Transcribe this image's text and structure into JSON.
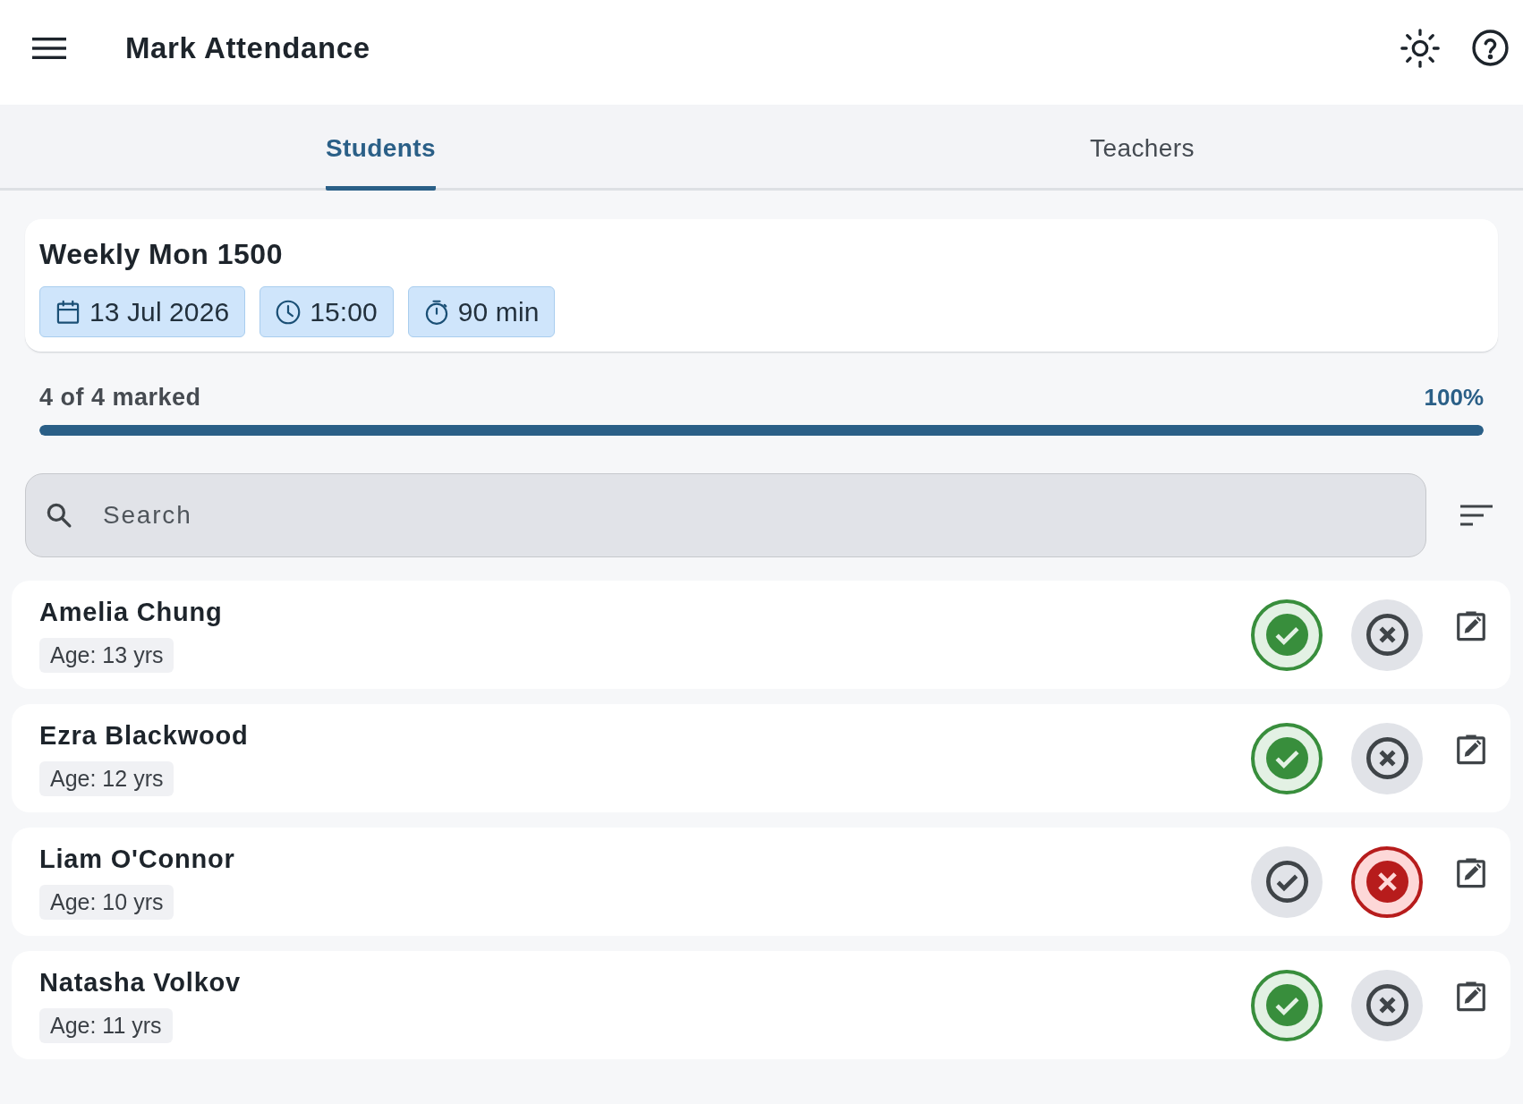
{
  "app_bar": {
    "title": "Mark Attendance"
  },
  "tabs": [
    {
      "label": "Students",
      "selected": true
    },
    {
      "label": "Teachers",
      "selected": false
    }
  ],
  "session": {
    "title": "Weekly Mon 1500",
    "chips": [
      {
        "kind": "date",
        "text": "13 Jul 2026"
      },
      {
        "kind": "time",
        "text": "15:00"
      },
      {
        "kind": "duration",
        "text": "90 min"
      }
    ]
  },
  "progress": {
    "label": "4 of 4 marked",
    "percent": "100%",
    "level": 1
  },
  "search": {
    "placeholder": "Search"
  },
  "students": [
    {
      "name": "Amelia Chung",
      "age": "Age: 13 yrs",
      "present": true,
      "absent": false
    },
    {
      "name": "Ezra Blackwood",
      "age": "Age: 12 yrs",
      "present": true,
      "absent": false
    },
    {
      "name": "Liam O'Connor",
      "age": "Age: 10 yrs",
      "present": false,
      "absent": true
    },
    {
      "name": "Natasha Volkov",
      "age": "Age: 11 yrs",
      "present": true,
      "absent": false
    }
  ]
}
